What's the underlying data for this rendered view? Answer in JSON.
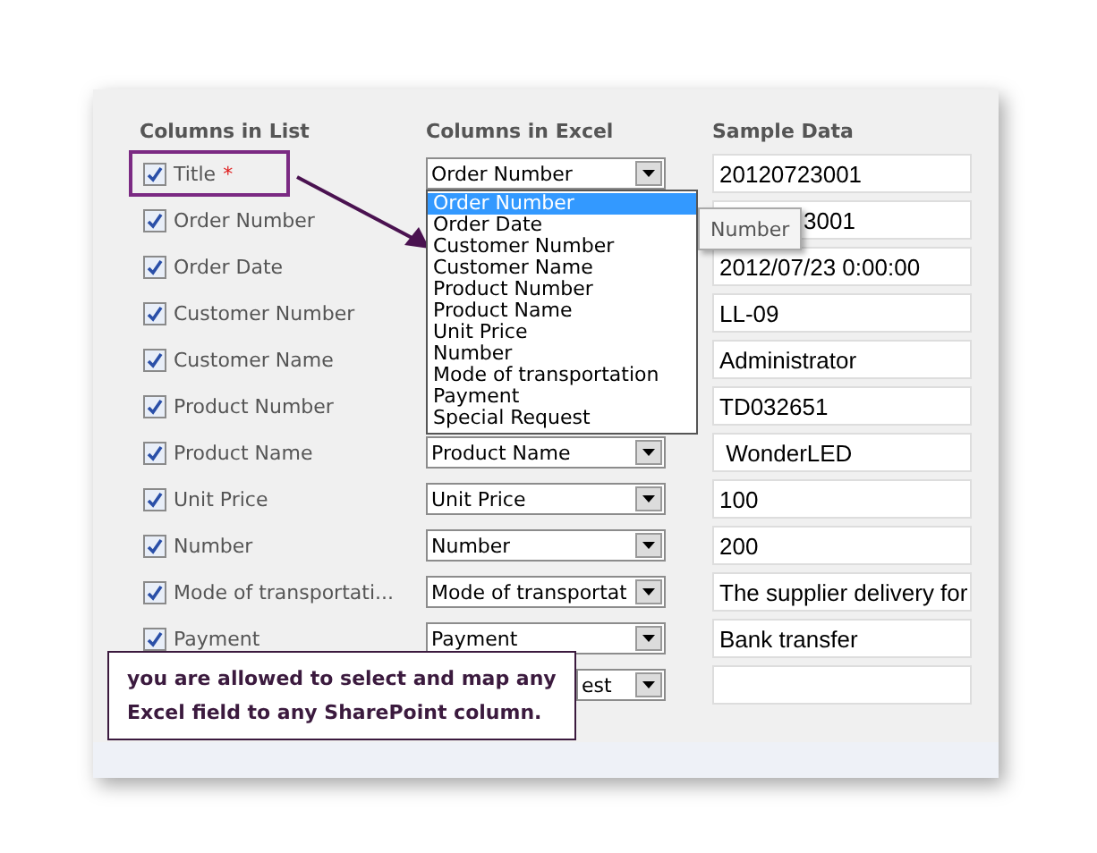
{
  "headers": {
    "list": "Columns in List",
    "excel": "Columns in Excel",
    "sample": "Sample Data"
  },
  "rows": [
    {
      "label": "Title",
      "required": "*",
      "checked": true,
      "highlighted": true,
      "excel": "Order Number",
      "sample": "20120723001"
    },
    {
      "label": "Order Number",
      "checked": true,
      "sample": "3001",
      "sample_partial": true
    },
    {
      "label": "Order Date",
      "checked": true,
      "sample": "2012/07/23 0:00:00"
    },
    {
      "label": "Customer Number",
      "checked": true,
      "sample": "LL-09"
    },
    {
      "label": "Customer Name",
      "checked": true,
      "sample": "Administrator"
    },
    {
      "label": "Product Number",
      "checked": true,
      "sample": "TD032651"
    },
    {
      "label": "Product Name",
      "checked": true,
      "excel": "Product Name",
      "sample": " WonderLED"
    },
    {
      "label": "Unit Price",
      "checked": true,
      "excel": "Unit Price",
      "sample": "100"
    },
    {
      "label": "Number",
      "checked": true,
      "excel": "Number",
      "sample": "200"
    },
    {
      "label": "Mode of transportati...",
      "checked": true,
      "excel": "Mode of transportat",
      "sample": "The supplier delivery for"
    },
    {
      "label": "Payment",
      "checked": true,
      "excel": "Payment",
      "sample": "Bank transfer"
    },
    {
      "excel": "est",
      "excel_partial": true,
      "sample": ""
    }
  ],
  "dropdown": {
    "options": [
      {
        "label": "Order Number",
        "selected": true
      },
      {
        "label": "Order Date",
        "selected": false
      },
      {
        "label": "Customer Number",
        "selected": false
      },
      {
        "label": "Customer Name",
        "selected": false
      },
      {
        "label": "Product Number",
        "selected": false
      },
      {
        "label": "Product Name",
        "selected": false
      },
      {
        "label": "Unit Price",
        "selected": false
      },
      {
        "label": "Number",
        "selected": false
      },
      {
        "label": "Mode of transportation",
        "selected": false
      },
      {
        "label": "Payment",
        "selected": false
      },
      {
        "label": "Special Request",
        "selected": false
      }
    ]
  },
  "tooltip": "Number",
  "callout": "you are allowed to select and map any Excel field to any SharePoint column."
}
